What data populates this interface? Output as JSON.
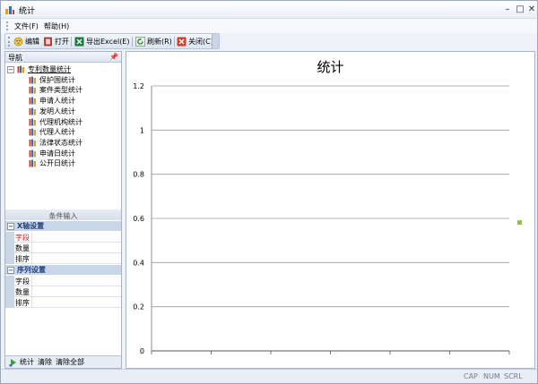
{
  "window": {
    "title": "统计",
    "controls": [
      "minimize-icon",
      "maximize-icon",
      "close-icon"
    ]
  },
  "menu": {
    "file": "文件(F)",
    "help": "帮助(H)"
  },
  "toolbar": {
    "edit": "编辑",
    "open": "打开",
    "export": "导出Excel(E)",
    "refresh": "刷新(R)",
    "close": "关闭(C)"
  },
  "nav": {
    "title": "导航",
    "root": "专利数量统计",
    "children": [
      "保护国统计",
      "案件类型统计",
      "申请人统计",
      "发明人统计",
      "代理机构统计",
      "代理人统计",
      "法律状态统计",
      "申请日统计",
      "公开日统计"
    ]
  },
  "conditions": {
    "header": "条件输入",
    "x_axis": {
      "title": "X轴设置",
      "fields": [
        "字段",
        "数量",
        "排序"
      ]
    },
    "series": {
      "title": "序列设置",
      "fields": [
        "字段",
        "数量",
        "排序"
      ]
    }
  },
  "footer": {
    "stat": "统计",
    "clear": "清除",
    "clear_all": "清除全部"
  },
  "status": {
    "cap": "CAP",
    "num": "NUM",
    "scrl": "SCRL"
  },
  "colors": {
    "legend_marker": "#8dc63f",
    "panel_border": "#a8b5c8",
    "group_text": "#1f3f7a"
  },
  "chart_data": {
    "type": "line",
    "title": "统计",
    "xlabel": "",
    "ylabel": "",
    "ylim": [
      0,
      1.2
    ],
    "yticks": [
      "0",
      "0.2",
      "0.4",
      "0.6",
      "0.8",
      "1",
      "1.2"
    ],
    "x_tick_count": 7,
    "grid": true,
    "series": [],
    "legend": "right"
  }
}
